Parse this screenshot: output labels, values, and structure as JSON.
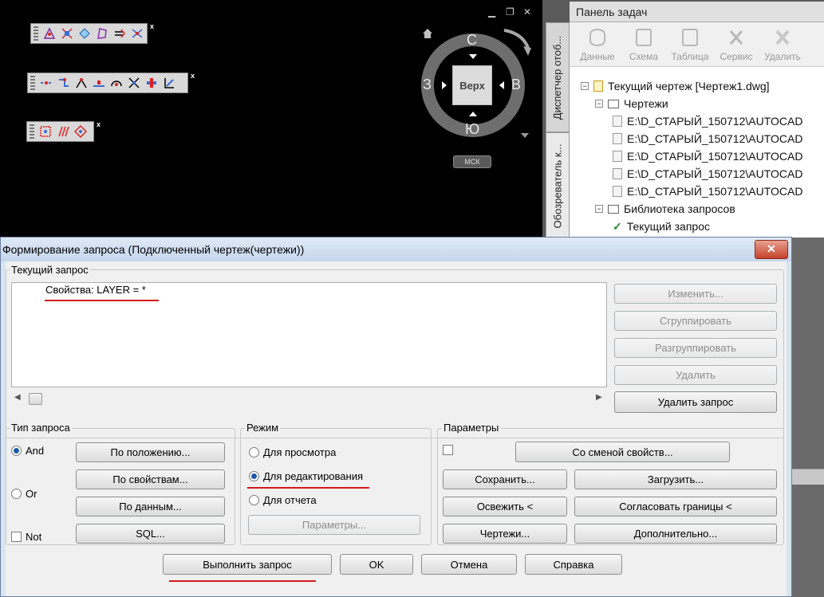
{
  "viewport": {
    "window_controls": {
      "minimize": "▁",
      "restore": "❐",
      "close": "✕"
    },
    "toolbar_close": "x",
    "toolbars": [
      {
        "icons": [
          "map-icon-1",
          "map-icon-2",
          "map-icon-3",
          "map-icon-4",
          "map-icon-5",
          "map-icon-6"
        ]
      },
      {
        "icons": [
          "map-icon-7",
          "map-icon-8",
          "map-icon-9",
          "map-icon-10",
          "map-icon-11",
          "map-icon-12",
          "map-icon-13",
          "map-icon-14"
        ]
      },
      {
        "icons": [
          "map-icon-15",
          "map-icon-16",
          "map-icon-17"
        ]
      }
    ],
    "viewcube": {
      "top": "Верх",
      "north": "С",
      "south": "Ю",
      "west": "З",
      "east": "В",
      "ucs": "МСК"
    }
  },
  "task_panel": {
    "title": "Панель задач",
    "vertical_tabs": [
      "Диспетчер отоб...",
      "Обозреватель к..."
    ],
    "tools": [
      "Данные",
      "Схема",
      "Таблица",
      "Сервис",
      "Удалить"
    ],
    "tree": {
      "root": "Текущий чертеж [Чертеж1.dwg]",
      "drawings_folder": "Чертежи",
      "drawings": [
        "E:\\D_СТАРЫЙ_150712\\AUTOCAD",
        "E:\\D_СТАРЫЙ_150712\\AUTOCAD",
        "E:\\D_СТАРЫЙ_150712\\AUTOCAD",
        "E:\\D_СТАРЫЙ_150712\\AUTOCAD",
        "E:\\D_СТАРЫЙ_150712\\AUTOCAD"
      ],
      "query_library": "Библиотека запросов",
      "current_query": "Текущий запрос"
    }
  },
  "dialog": {
    "title": "Формирование запроса (Подключенный чертеж(чертежи))",
    "close": "✕",
    "current_query": {
      "label": "Текущий запрос",
      "text": "Свойства: LAYER = *",
      "buttons": {
        "edit": "Изменить...",
        "group": "Сгруппировать",
        "ungroup": "Разгруппировать",
        "delete": "Удалить",
        "delete_query": "Удалить запрос"
      }
    },
    "query_type": {
      "label": "Тип запроса",
      "and": "And",
      "or": "Or",
      "not": "Not",
      "selected": "And",
      "buttons": {
        "location": "По положению...",
        "property": "По свойствам...",
        "data": "По данным...",
        "sql": "SQL..."
      }
    },
    "mode": {
      "label": "Режим",
      "preview": "Для просмотра",
      "edit": "Для редактирования",
      "report": "Для отчета",
      "selected": "Для редактирования",
      "params_button": "Параметры..."
    },
    "params": {
      "label": "Параметры",
      "change_props": "Со сменой свойств...",
      "save": "Сохранить...",
      "load": "Загрузить...",
      "refresh": "Освежить <",
      "match_bounds": "Согласовать границы <",
      "drawings": "Чертежи...",
      "additional": "Дополнительно..."
    },
    "footer": {
      "execute": "Выполнить запрос",
      "ok": "OK",
      "cancel": "Отмена",
      "help": "Справка"
    }
  },
  "colors": {
    "annotation_red": "#d31a1a",
    "radio_selected": "#1c5aa6"
  }
}
